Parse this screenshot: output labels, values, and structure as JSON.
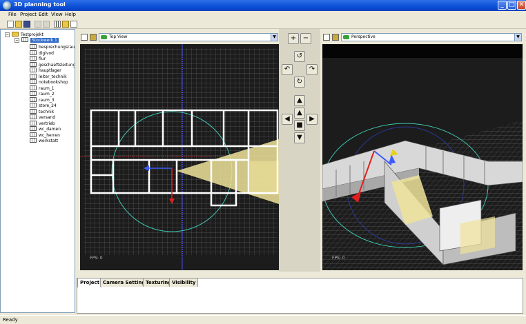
{
  "window": {
    "title": "3D planning tool",
    "min_glyph": "_",
    "max_glyph": "□",
    "close_glyph": "✕"
  },
  "menu": [
    "File",
    "Project",
    "Edit",
    "View",
    "Help"
  ],
  "toolbar": [
    "new-icon",
    "open-folder-icon",
    "save-icon",
    "cut-icon",
    "copy-icon",
    "grid-icon",
    "copy-layout-icon",
    "export-icon"
  ],
  "tree": {
    "root": "Testprojekt",
    "floor": "Stockwerk 1",
    "rooms": [
      "besprechungsraum",
      "digivod",
      "flur",
      "geschaeftsleitung",
      "hauptlager",
      "leiter_technik",
      "notebookshop",
      "raum_1",
      "raum_2",
      "raum_3",
      "store_24",
      "technik",
      "versand",
      "vertrieb",
      "wc_damen",
      "wc_herren",
      "werkstatt"
    ]
  },
  "left_viewport": {
    "view": "Top View",
    "fps": "FPS: 0"
  },
  "right_viewport": {
    "view": "Perspective",
    "fps": "FPS: 0"
  },
  "controls": {
    "zoom_in": "+",
    "zoom_out": "−",
    "rotate_ccw": "↺",
    "rotate_left": "↶",
    "rotate_right": "↷",
    "rotate_cw": "↻",
    "up": "▲",
    "forward": "▲",
    "left": "◀",
    "center": "■",
    "right": "▶",
    "down": "▼"
  },
  "tabs": [
    "Project",
    "Camera Settings",
    "Texturing",
    "Visibility"
  ],
  "status": "Ready",
  "colors": {
    "title_blue": "#0a4fd6",
    "viewport_bg": "#1c1c1c",
    "grid": "#5a5a5a",
    "cone": "#efe39a",
    "axis_blue": "#3e5cff",
    "axis_red": "#e02020",
    "gizmo_circle": "#3fc6b0"
  }
}
